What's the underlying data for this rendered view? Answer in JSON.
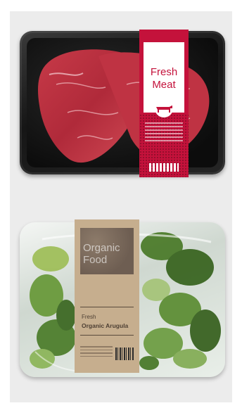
{
  "meat_pack": {
    "title_line1": "Fresh",
    "title_line2": "Meat",
    "brand_color": "#c4123b",
    "icon": "cow-icon"
  },
  "salad_pack": {
    "badge_line1": "Organic",
    "badge_line2": "Food",
    "subtitle": "Fresh",
    "product": "Organic Arugula",
    "label_color": "#c6ae8e",
    "icon": "barcode-icon"
  }
}
